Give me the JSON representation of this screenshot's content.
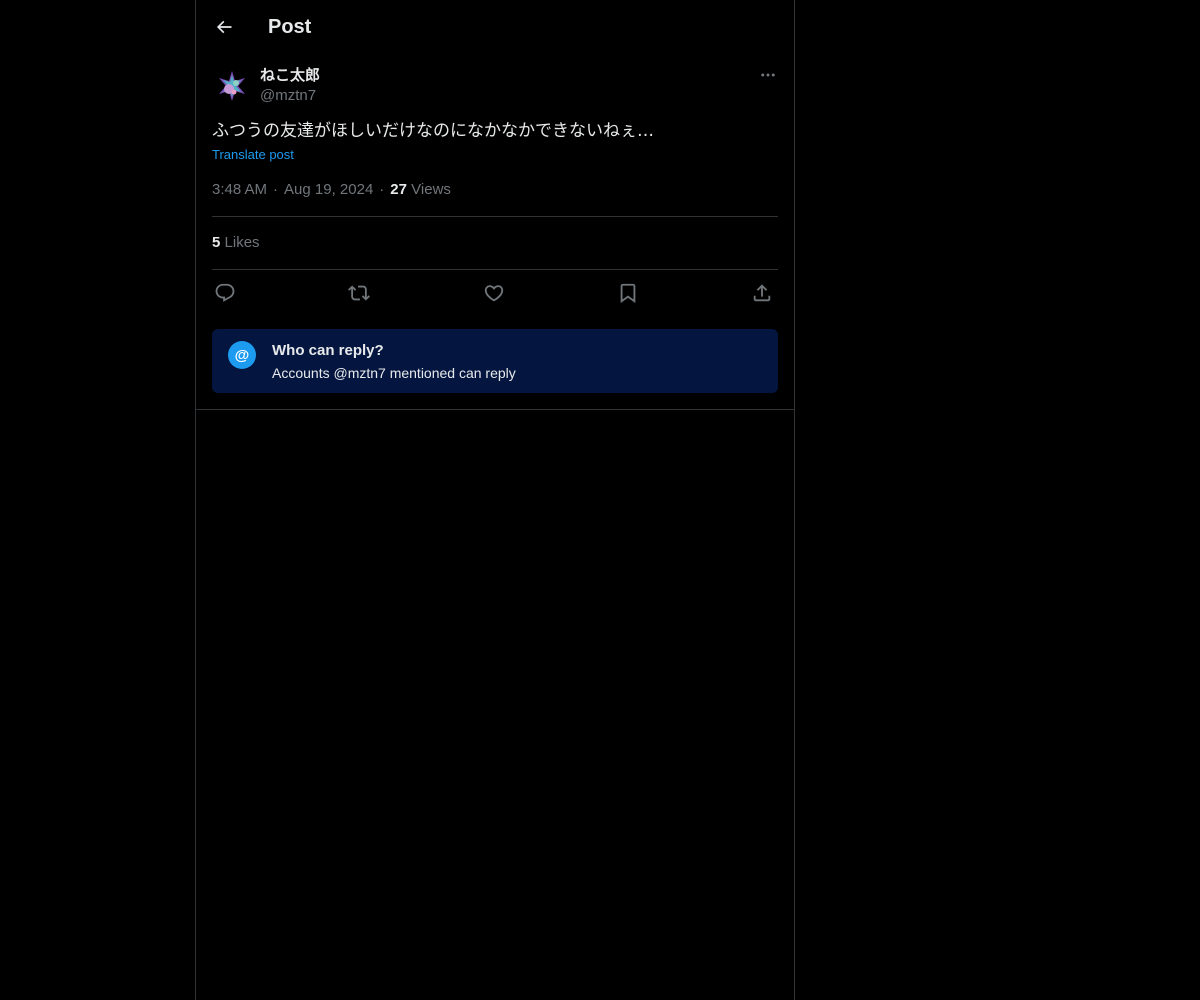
{
  "header": {
    "back_icon": "arrow-left-icon",
    "title": "Post"
  },
  "author": {
    "display_name": "ねこ太郎",
    "handle": "@mztn7",
    "avatar_icon": "avatar-image",
    "more_icon": "more-horizontal-icon"
  },
  "post": {
    "text": "ふつうの友達がほしいだけなのになかなかできないねぇ…",
    "translate_label": "Translate post",
    "time": "3:48 AM",
    "separator": "·",
    "date": "Aug 19, 2024",
    "views_count": "27",
    "views_label": "Views"
  },
  "stats": {
    "likes_count": "5",
    "likes_label": "Likes"
  },
  "actions": [
    {
      "name": "reply",
      "icon": "reply-icon"
    },
    {
      "name": "repost",
      "icon": "repost-icon"
    },
    {
      "name": "like",
      "icon": "heart-icon"
    },
    {
      "name": "bookmark",
      "icon": "bookmark-icon"
    },
    {
      "name": "share",
      "icon": "share-icon"
    }
  ],
  "reply_restriction": {
    "icon_glyph": "@",
    "title": "Who can reply?",
    "description": "Accounts @mztn7 mentioned can reply"
  },
  "colors": {
    "background": "#000000",
    "text": "#e7e9ea",
    "muted": "#71767b",
    "accent": "#1d9bf0",
    "border": "#2f3336",
    "reply_box": "#041640"
  }
}
